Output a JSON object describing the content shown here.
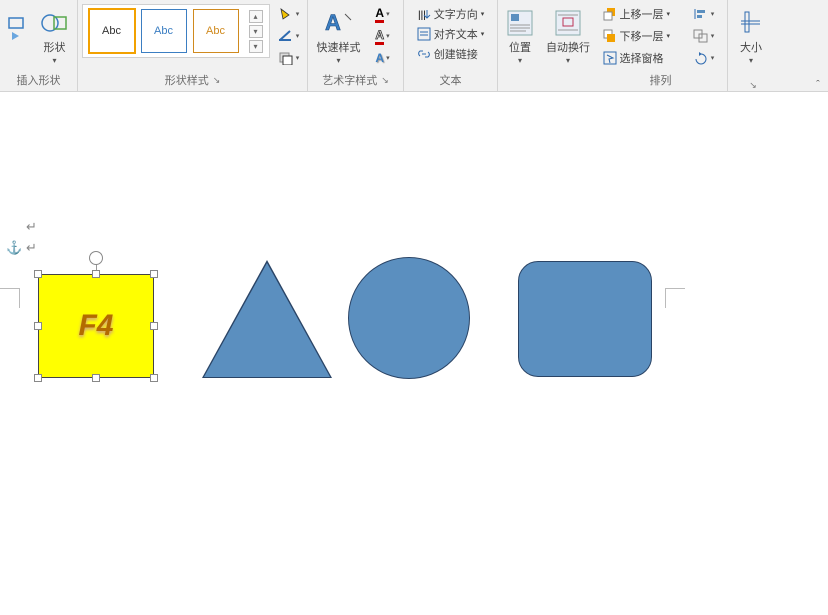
{
  "ribbon": {
    "groups": {
      "insert_shapes": {
        "label": "插入形状",
        "shapes_btn": "形状"
      },
      "shape_styles": {
        "label": "形状样式",
        "gallery_text": "Abc",
        "fill": "形状填充",
        "outline": "形状轮廓",
        "effects": "形状效果"
      },
      "wordart_styles": {
        "label": "艺术字样式",
        "quick_styles": "快速样式"
      },
      "text": {
        "label": "文本",
        "direction": "文字方向",
        "align": "对齐文本",
        "link": "创建链接"
      },
      "position": {
        "label": "位置"
      },
      "wrap": {
        "label": "自动换行"
      },
      "arrange": {
        "label": "排列",
        "bring_forward": "上移一层",
        "send_backward": "下移一层",
        "selection_pane": "选择窗格"
      },
      "size": {
        "label": "大小"
      }
    }
  },
  "canvas": {
    "selected_shape_text": "F4"
  }
}
